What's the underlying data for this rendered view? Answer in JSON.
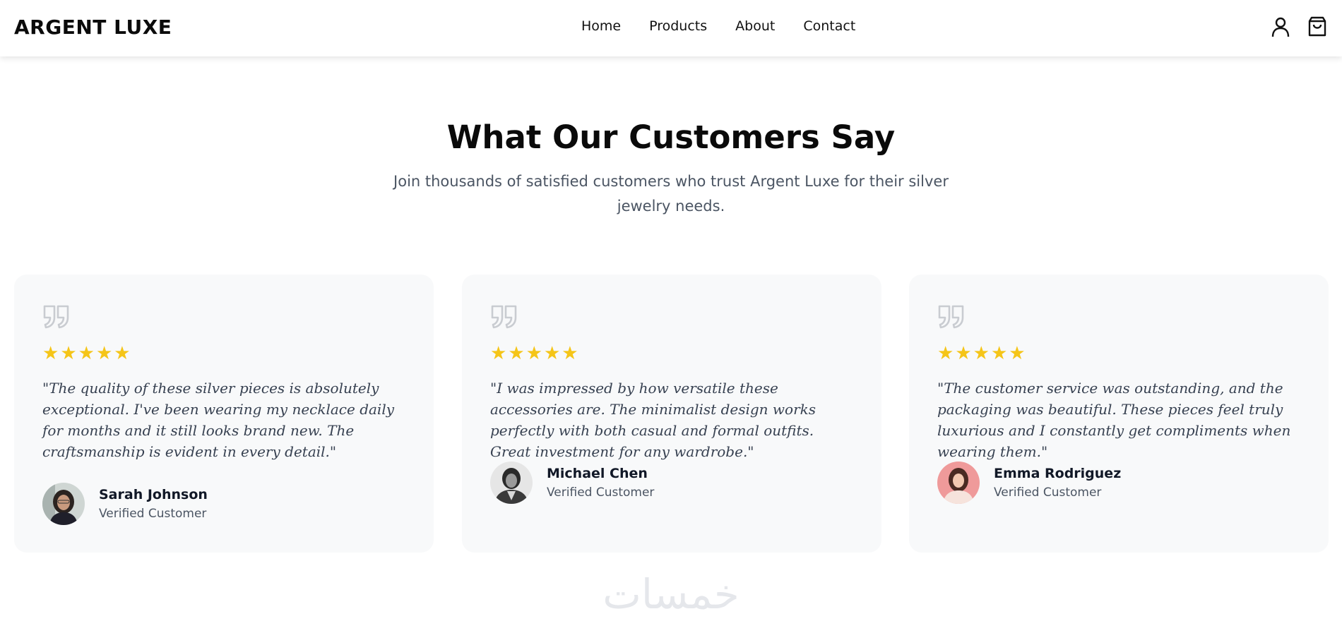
{
  "header": {
    "brand": "ARGENT LUXE",
    "nav": [
      "Home",
      "Products",
      "About",
      "Contact"
    ],
    "icons": [
      "user-icon",
      "shopping-bag-icon"
    ]
  },
  "section": {
    "title": "What Our Customers Say",
    "subtitle": "Join thousands of satisfied customers who trust Argent Luxe for their silver jewelry needs."
  },
  "testimonials": [
    {
      "rating": 5,
      "text": "\"The quality of these silver pieces is absolutely exceptional. I've been wearing my necklace daily for months and it still looks brand new. The craftsmanship is evident in every detail.\"",
      "name": "Sarah Johnson",
      "role": "Verified Customer"
    },
    {
      "rating": 5,
      "text": "\"I was impressed by how versatile these accessories are. The minimalist design works perfectly with both casual and formal outfits. Great investment for any wardrobe.\"",
      "name": "Michael Chen",
      "role": "Verified Customer"
    },
    {
      "rating": 5,
      "text": "\"The customer service was outstanding, and the packaging was beautiful. These pieces feel truly luxurious and I constantly get compliments when wearing them.\"",
      "name": "Emma Rodriguez",
      "role": "Verified Customer"
    }
  ],
  "watermark": "خمسات",
  "colors": {
    "star": "#f5c518",
    "card_bg": "#f8f9fa",
    "quote_icon": "#c9ccd1"
  }
}
